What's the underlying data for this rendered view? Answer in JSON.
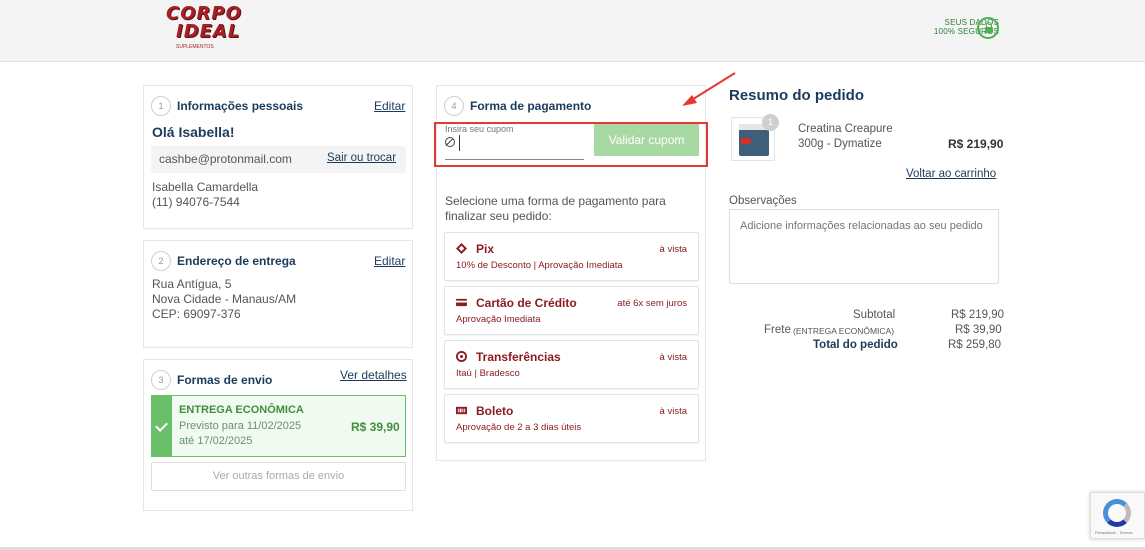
{
  "header": {
    "logo": {
      "line1": "CORPO",
      "line2": "IDEAL",
      "tagline": "SUPLEMENTOS"
    },
    "secure": {
      "line1": "SEUS DADOS",
      "line2": "100% SEGUROS"
    }
  },
  "personal": {
    "step": "1",
    "title": "Informações pessoais",
    "edit": "Editar",
    "greeting": "Olá Isabella!",
    "email": "cashbe@protonmail.com",
    "switch": "Sair ou trocar",
    "name": "Isabella Camardella",
    "phone": "(11) 94076-7544"
  },
  "address": {
    "step": "2",
    "title": "Endereço de entrega",
    "edit": "Editar",
    "line1": "Rua Antígua, 5",
    "line2": "Nova Cidade - Manaus/AM",
    "line3": "CEP: 69097-376"
  },
  "shipping": {
    "step": "3",
    "title": "Formas de envio",
    "details": "Ver detalhes",
    "option_name": "ENTREGA ECONÔMICA",
    "date1": "Previsto para 11/02/2025",
    "date2": "até 17/02/2025",
    "price": "R$ 39,90",
    "other": "Ver outras formas de envio"
  },
  "payment": {
    "step": "4",
    "title": "Forma de pagamento",
    "coupon_label": "Insira seu cupom",
    "coupon_value": "",
    "coupon_button": "Validar cupom",
    "instruction1": "Selecione uma forma de pagamento para",
    "instruction2": "finalizar seu pedido:",
    "options": [
      {
        "name": "Pix",
        "sub": "10% de Desconto | Aprovação Imediata",
        "right": "à vista",
        "icon": "pix-icon"
      },
      {
        "name": "Cartão de Crédito",
        "sub": "Aprovação Imediata",
        "right": "até 6x sem juros",
        "icon": "credit-card-icon"
      },
      {
        "name": "Transferências",
        "sub": "Itaú | Bradesco",
        "right": "à vista",
        "icon": "transfer-icon"
      },
      {
        "name": "Boleto",
        "sub": "Aprovação de 2 a 3 dias úteis",
        "right": "à vista",
        "icon": "barcode-icon"
      }
    ]
  },
  "summary": {
    "title": "Resumo do pedido",
    "product_line1": "Creatina Creapure",
    "product_line2": "300g - Dymatize",
    "product_price": "R$ 219,90",
    "quantity": "1",
    "back_to_cart": "Voltar ao carrinho",
    "notes_label": "Observações",
    "notes_placeholder": "Adicione informações relacionadas ao seu pedido",
    "subtotal_label": "Subtotal",
    "subtotal_value": "R$ 219,90",
    "shipping_label": "Frete",
    "shipping_type": "(ENTREGA ECONÔMICA)",
    "shipping_value": "R$ 39,90",
    "total_label": "Total do pedido",
    "total_value": "R$ 259,80"
  },
  "recaptcha": {
    "text": "Privacidade - Termos"
  },
  "colors": {
    "brand": "#a81f25",
    "accent_green": "#6abf69",
    "navy": "#1b3b5a",
    "highlight": "#e53935"
  }
}
